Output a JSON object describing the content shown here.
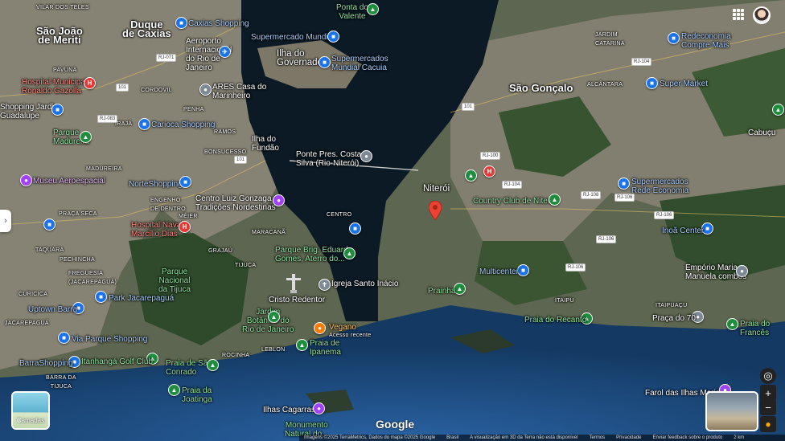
{
  "colors": {
    "water": "#0b1a24",
    "sea": "#1d4f86",
    "land": "#5c6a4c",
    "urban": "#8d877a",
    "forest": "#2f4a2c"
  },
  "places": {
    "sao_joao": "São João\nde Meriti",
    "duque": "Duque\nde Caxias",
    "vilar": "VILAR DOS TELES",
    "ponta_valente": "Ponta do\nValente",
    "caxias_shopping": "Caxias Shopping",
    "aeroporto": "Aeroporto\nInternacional\ndo Rio de\nJaneiro",
    "supermercado_mundial": "Supermercado Mundial",
    "ilha_governador": "Ilha do\nGovernador",
    "supermercados_cacuia": "Supermercados\nMundial Cacuia",
    "jardim_catarina": "JARDIM\nCATARINA",
    "redeconomia": "Redeconomia\nCompre Mais",
    "sao_goncalo": "São Gonçalo",
    "alcantara": "ALCÂNTARA",
    "super_market": "Super Market",
    "cabucu": "Cabuçu",
    "pavuna": "PAVUNA",
    "hospital_gazolla": "Hospital Municipal\nRonaldo Gazolla",
    "ares": "ARES Casa do\nMarinheiro",
    "cordovil": "CORDOVIL",
    "penha": "PENHA",
    "shopping_guadalupe": "Shopping Jardim\nGuadalupe",
    "iraja": "IRAJÁ",
    "carioca_shopping": "Carioca Shopping",
    "ramos": "RAMOS",
    "ilha_fundao": "Ilha do\nFundão",
    "parque_madureira": "Parque\nMadureira",
    "bonsucesso": "BONSUCESSO",
    "ponte": "Ponte Pres. Costa e\nSilva (Rio-Niterói)",
    "madureira": "MADUREIRA",
    "museu_aero": "Museu Aeroespacial",
    "norteshopping": "NorteShopping",
    "engenho": "ENGENHO\nDE DENTRO",
    "centro_gonzaga": "Centro Luiz Gonzaga de\nTradições Nordestinas",
    "niteroi": "Niterói",
    "country_club": "Country Club de Niterói",
    "supermercados_rede": "Supermercados\nRede Economia",
    "praca_seca": "PRAÇA SECA",
    "hospital_naval": "Hospital Naval\nMarcílio Dias",
    "meier": "MÉIER",
    "centro": "CENTRO",
    "maracana": "MARACANÃ",
    "inoa_center": "Inoã Center",
    "taquara": "TAQUARA",
    "pechincha": "PECHINCHA",
    "grajau": "GRAJAÚ",
    "tijuca": "TIJUCA",
    "parque_gomes": "Parque Brig. Eduardo\nGomes, Aterro do...",
    "parque_tijuca": "Parque\nNacional\nda Tijuca",
    "multicenter": "Multicenter",
    "emporio": "Empório Maria\nManuela combos",
    "freguesia": "FREGUESIA\n(JACAREPAGUÁ)",
    "igreja": "Igreja Santo Inácio",
    "curicica": "CURICICA",
    "park_jacarepagua": "Park Jacarepaguá",
    "prainha": "Prainha",
    "cristo": "Cristo Redentor",
    "uptown": "Uptown Barra",
    "jardim_botanico": "Jardim\nBotânico do\nRio de Janeiro",
    "vegano": "Vegano",
    "acesso_recente": "Acesso recente",
    "praia_recanto": "Praia do Recanto",
    "praca_70": "Praça do 70",
    "jacarepagua": "JACAREPAGUÁ",
    "via_parque": "Via Parque Shopping",
    "leblon": "LEBLON",
    "praia_ipanema": "Praia de\nIpanema",
    "itaipu": "ITAIPU",
    "itaipuacu": "ITAIPUAÇU",
    "praia_frances": "Praia do\nFrancês",
    "rocinha": "ROCINHA",
    "barrashopping": "BarraShopping",
    "itanhanga": "Itanhangá Golf Club",
    "praia_conrado": "Praia de São\nConrado",
    "barra_tijuca": "BARRA DA\nTIJUCA",
    "praia_joatinga": "Praia da\nJoatinga",
    "farol": "Farol das Ilhas Maricás",
    "ilhas_cagarras": "Ilhas Cagarras",
    "monumento": "Monumento\nNatural do..."
  },
  "layers_label": "Camadas",
  "google_logo": "Google",
  "attribution": {
    "imagery": "Imagens ©2025 TerraMetrics, Dados do mapa ©2025 Google",
    "country": "Brasil",
    "notice": "A visualização em 3D da Terra não está disponível",
    "terms": "Termos",
    "privacy": "Privacidade",
    "feedback": "Enviar feedback sobre o produto",
    "scale": "2 km"
  },
  "roads": [
    "RJ-071",
    "101",
    "RJ-083",
    "101",
    "RJ-104",
    "RJ-106",
    "RJ-100",
    "101",
    "RJ-104",
    "RJ-108",
    "RJ-106",
    "RJ-106",
    "RJ-106"
  ]
}
